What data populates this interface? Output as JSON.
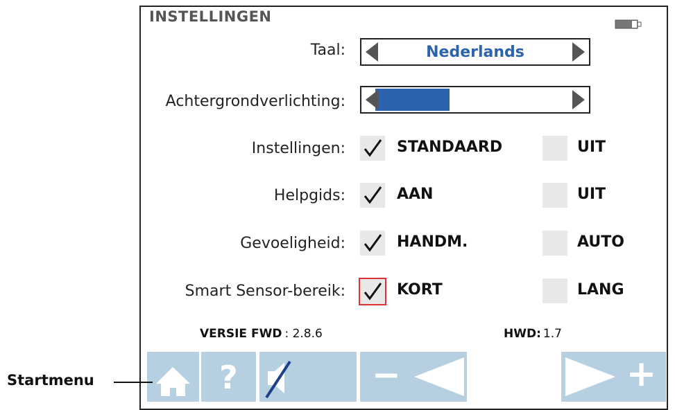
{
  "screen": {
    "title": "INSTELLINGEN"
  },
  "language": {
    "label": "Taal:",
    "value": "Nederlands"
  },
  "backlight": {
    "label": "Achtergrondverlichting:",
    "level_percent": 37
  },
  "rows": [
    {
      "label": "Instellingen:",
      "option_a": "STANDAARD",
      "option_b": "UIT",
      "selected": "a"
    },
    {
      "label": "Helpgids:",
      "option_a": "AAN",
      "option_b": "UIT",
      "selected": "a"
    },
    {
      "label": "Gevoeligheid:",
      "option_a": "HANDM.",
      "option_b": "AUTO",
      "selected": "a"
    },
    {
      "label": "Smart Sensor-bereik:",
      "option_a": "KORT",
      "option_b": "LANG",
      "selected": "a"
    }
  ],
  "version": {
    "fwd_label": "VERSIE FWD",
    "fwd_value": ": 2.8.6",
    "hwd_label": "HWD:",
    "hwd_value": "1.7"
  },
  "toolbar": {
    "home_icon": "home-icon",
    "help_glyph": "?",
    "mute_icon": "speaker-muted-icon",
    "minus_glyph": "−",
    "plus_glyph": "+"
  },
  "callout": {
    "label": "Startmenu"
  },
  "colors": {
    "accent": "#2d63ad",
    "button": "#b6d0e2",
    "selected_border": "#dd3333"
  }
}
